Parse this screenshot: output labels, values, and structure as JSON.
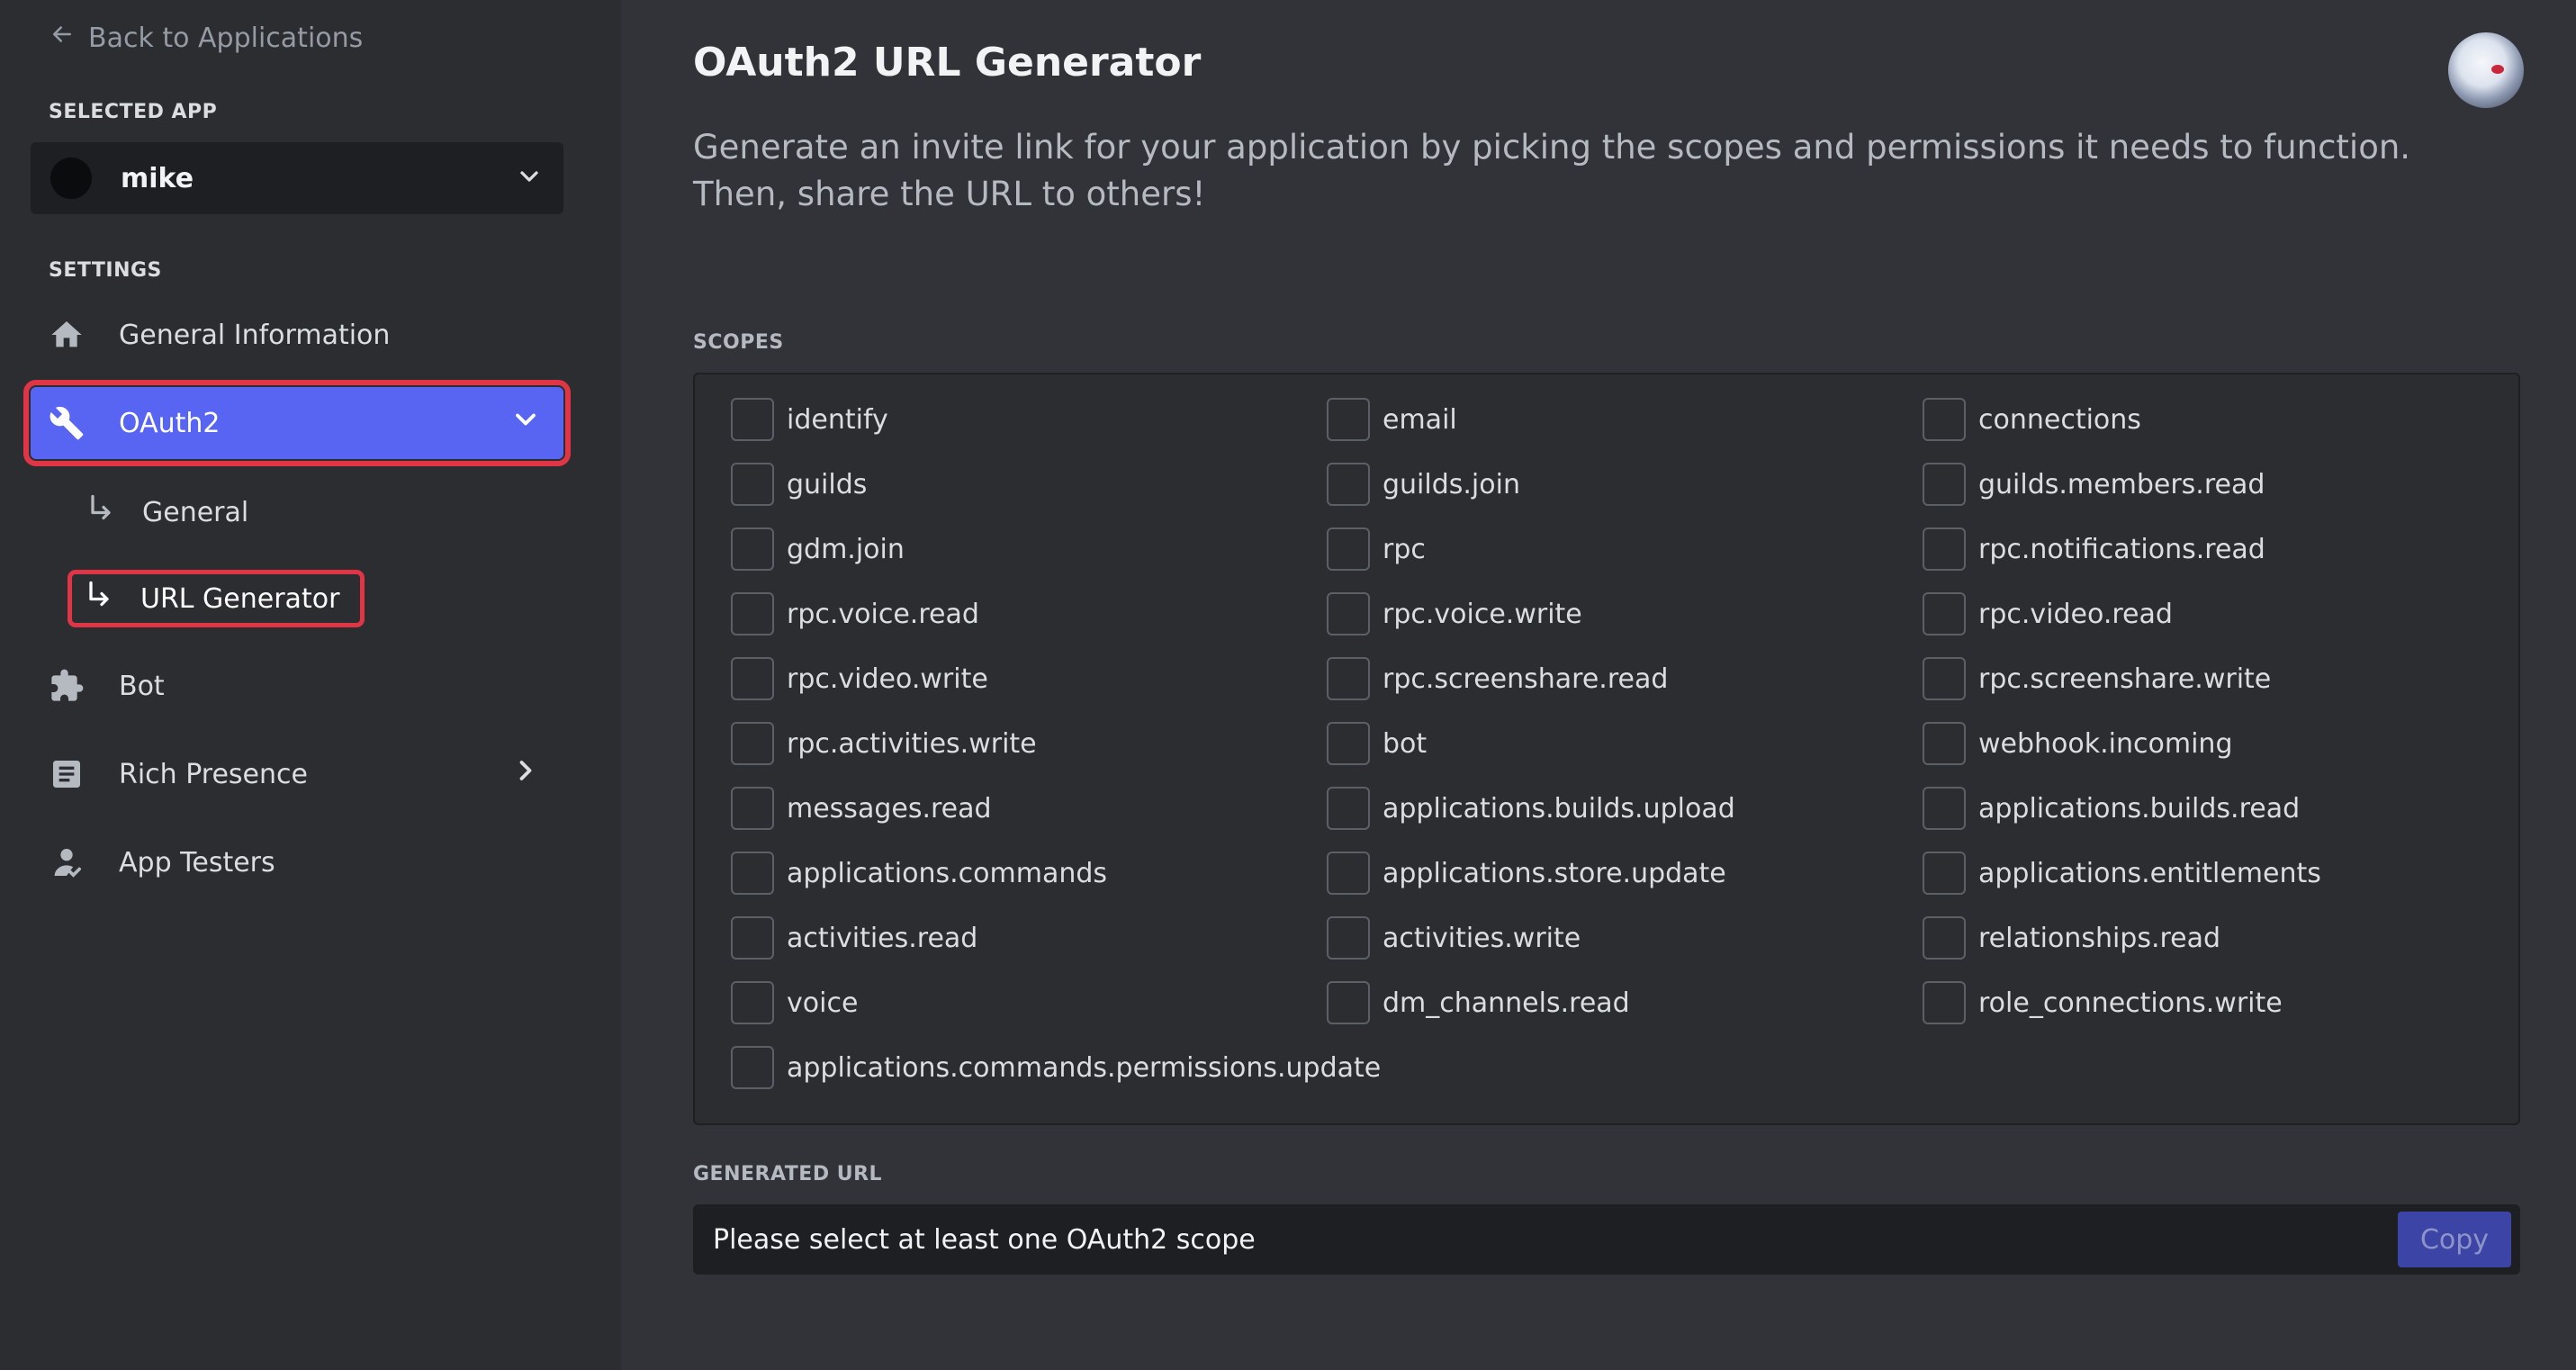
{
  "sidebar": {
    "back_label": "Back to Applications",
    "selected_app_label": "SELECTED APP",
    "app_name": "mike",
    "settings_label": "SETTINGS",
    "items": {
      "general_information": "General Information",
      "oauth2": "OAuth2",
      "general": "General",
      "url_generator": "URL Generator",
      "bot": "Bot",
      "rich_presence": "Rich Presence",
      "app_testers": "App Testers"
    }
  },
  "main": {
    "title": "OAuth2 URL Generator",
    "description": "Generate an invite link for your application by picking the scopes and permissions it needs to function. Then, share the URL to others!",
    "scopes_label": "SCOPES",
    "scopes": [
      "identify",
      "email",
      "connections",
      "guilds",
      "guilds.join",
      "guilds.members.read",
      "gdm.join",
      "rpc",
      "rpc.notifications.read",
      "rpc.voice.read",
      "rpc.voice.write",
      "rpc.video.read",
      "rpc.video.write",
      "rpc.screenshare.read",
      "rpc.screenshare.write",
      "rpc.activities.write",
      "bot",
      "webhook.incoming",
      "messages.read",
      "applications.builds.upload",
      "applications.builds.read",
      "applications.commands",
      "applications.store.update",
      "applications.entitlements",
      "activities.read",
      "activities.write",
      "relationships.read",
      "voice",
      "dm_channels.read",
      "role_connections.write",
      "applications.commands.permissions.update"
    ],
    "generated_url_label": "GENERATED URL",
    "generated_url_placeholder": "Please select at least one OAuth2 scope",
    "copy_label": "Copy"
  },
  "colors": {
    "accent": "#5865f2",
    "highlight_border": "#e03545",
    "background": "#313338",
    "sidebar_background": "#2b2d31"
  }
}
